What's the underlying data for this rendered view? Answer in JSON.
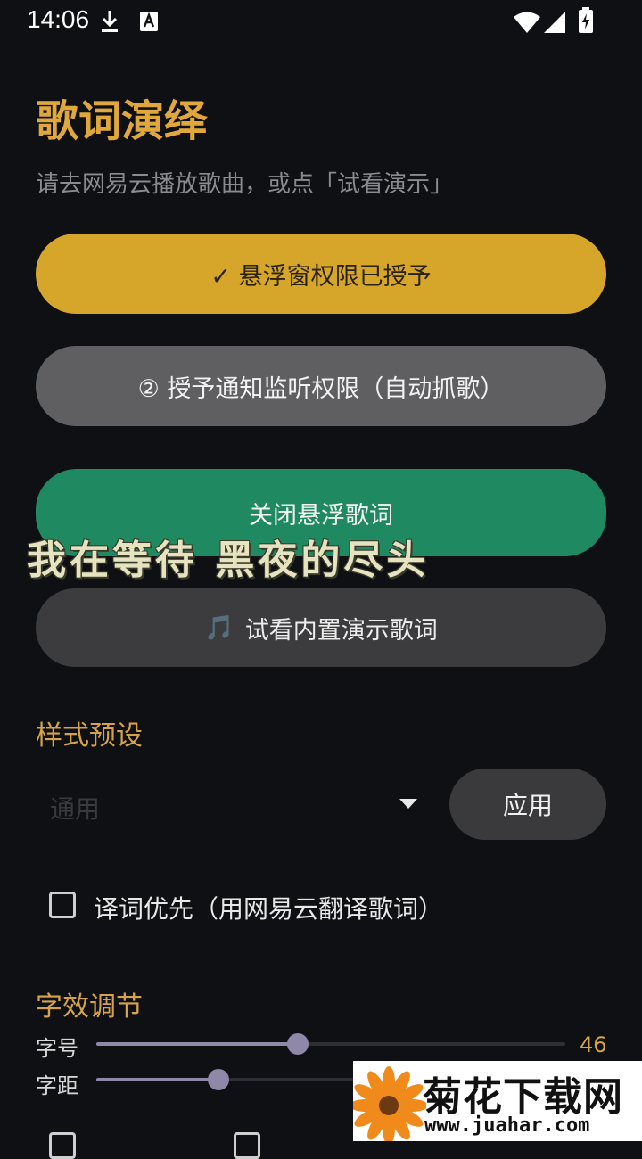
{
  "status_bar": {
    "time": "14:06",
    "icons": [
      "download-icon",
      "keyboard-a-icon",
      "wifi-icon",
      "cell-signal-icon",
      "battery-charging-icon"
    ]
  },
  "header": {
    "title": "歌词演绎",
    "subtitle": "请去网易云播放歌曲，或点「试看演示」"
  },
  "buttons": {
    "overlay_permission": "✓ 悬浮窗权限已授予",
    "notification_permission": "② 授予通知监听权限（自动抓歌）",
    "close_floating": "关闭悬浮歌词",
    "demo": "试看内置演示歌词",
    "demo_icon": "🎵"
  },
  "floating_lyric": "我在等待 黑夜的尽头",
  "style_preset": {
    "section_title": "样式预设",
    "selected": "通用",
    "apply_label": "应用"
  },
  "options": {
    "translation_first_label": "译词优先（用网易云翻译歌词）",
    "translation_first_checked": false
  },
  "effects": {
    "section_title": "字效调节",
    "font_size": {
      "label": "字号",
      "value": "46",
      "fraction": 0.43
    },
    "letter_spacing": {
      "label": "字距",
      "fraction": 0.26
    }
  },
  "watermark": {
    "text": "菊花下载网",
    "url": "www.juahar.com"
  },
  "colors": {
    "accent_gold": "#d6a62a",
    "green": "#1f8a62",
    "background": "#0f1014"
  }
}
